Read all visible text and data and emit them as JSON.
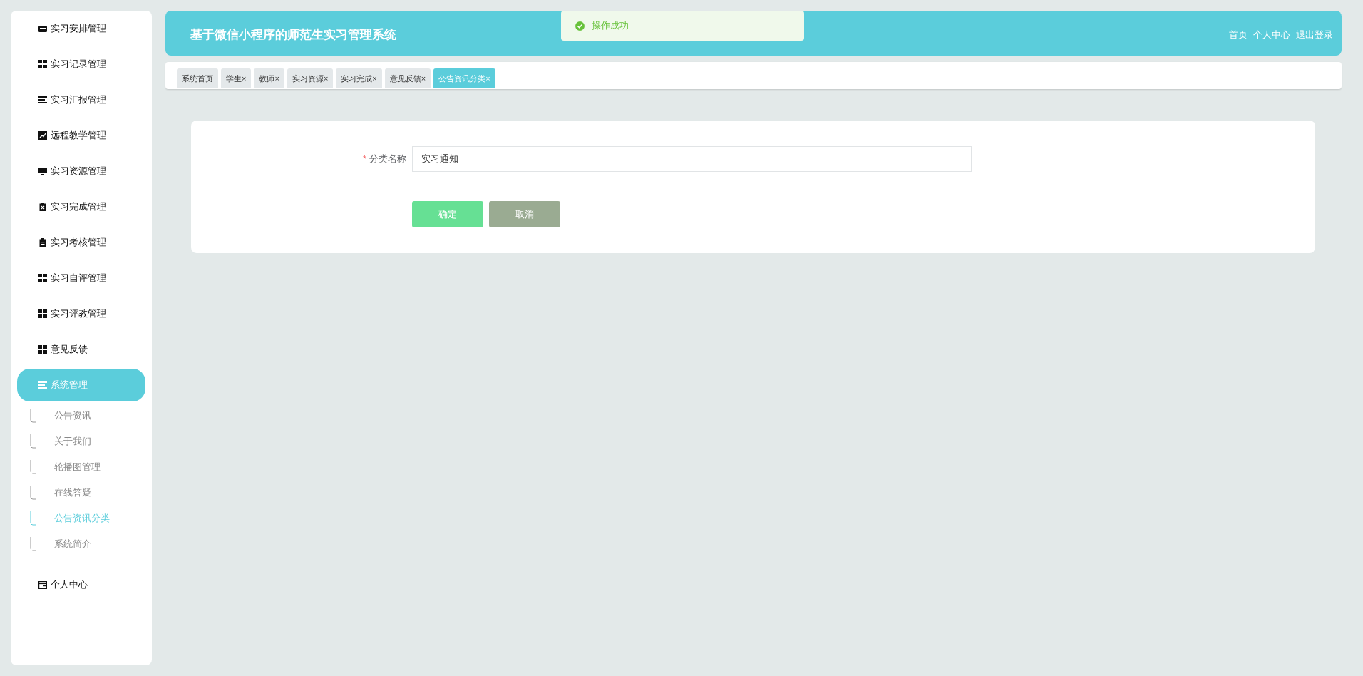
{
  "sidebar": {
    "items": [
      {
        "label": "实习安排管理",
        "kind": "inbox",
        "selected": false
      },
      {
        "label": "实习记录管理",
        "kind": "grid",
        "selected": false
      },
      {
        "label": "实习汇报管理",
        "kind": "list",
        "selected": false
      },
      {
        "label": "远程教学管理",
        "kind": "chart",
        "selected": false
      },
      {
        "label": "实习资源管理",
        "kind": "monitor",
        "selected": false
      },
      {
        "label": "实习完成管理",
        "kind": "clipboard-x",
        "selected": false
      },
      {
        "label": "实习考核管理",
        "kind": "clipboard",
        "selected": false
      },
      {
        "label": "实习自评管理",
        "kind": "grid",
        "selected": false
      },
      {
        "label": "实习评教管理",
        "kind": "grid",
        "selected": false
      },
      {
        "label": "意见反馈",
        "kind": "grid",
        "selected": false
      },
      {
        "label": "系统管理",
        "kind": "list",
        "selected": true,
        "children": [
          {
            "label": "公告资讯",
            "selected": false
          },
          {
            "label": "关于我们",
            "selected": false
          },
          {
            "label": "轮播图管理",
            "selected": false
          },
          {
            "label": "在线答疑",
            "selected": false
          },
          {
            "label": "公告资讯分类",
            "selected": true
          },
          {
            "label": "系统简介",
            "selected": false
          }
        ]
      },
      {
        "label": "个人中心",
        "kind": "wallet",
        "selected": false
      }
    ]
  },
  "header": {
    "title": "基于微信小程序的师范生实习管理系统",
    "links": [
      "首页",
      "个人中心",
      "退出登录"
    ]
  },
  "toast": {
    "message": "操作成功"
  },
  "tabs": [
    {
      "label": "系统首页",
      "selected": false
    },
    {
      "label": "学生",
      "close": "×",
      "selected": false
    },
    {
      "label": "教师",
      "close": "×",
      "selected": false
    },
    {
      "label": "实习资源",
      "close": "×",
      "selected": false
    },
    {
      "label": "实习完成",
      "close": "×",
      "selected": false
    },
    {
      "label": "意见反馈",
      "close": "×",
      "selected": false
    },
    {
      "label": "公告资讯分类",
      "close": "×",
      "selected": true
    }
  ],
  "form": {
    "fields": [
      {
        "required_mark": "*",
        "label": "分类名称",
        "value": "实习通知"
      }
    ],
    "buttons": [
      {
        "label": "确定",
        "kind": "primary"
      },
      {
        "label": "取消",
        "kind": "secondary"
      }
    ]
  }
}
